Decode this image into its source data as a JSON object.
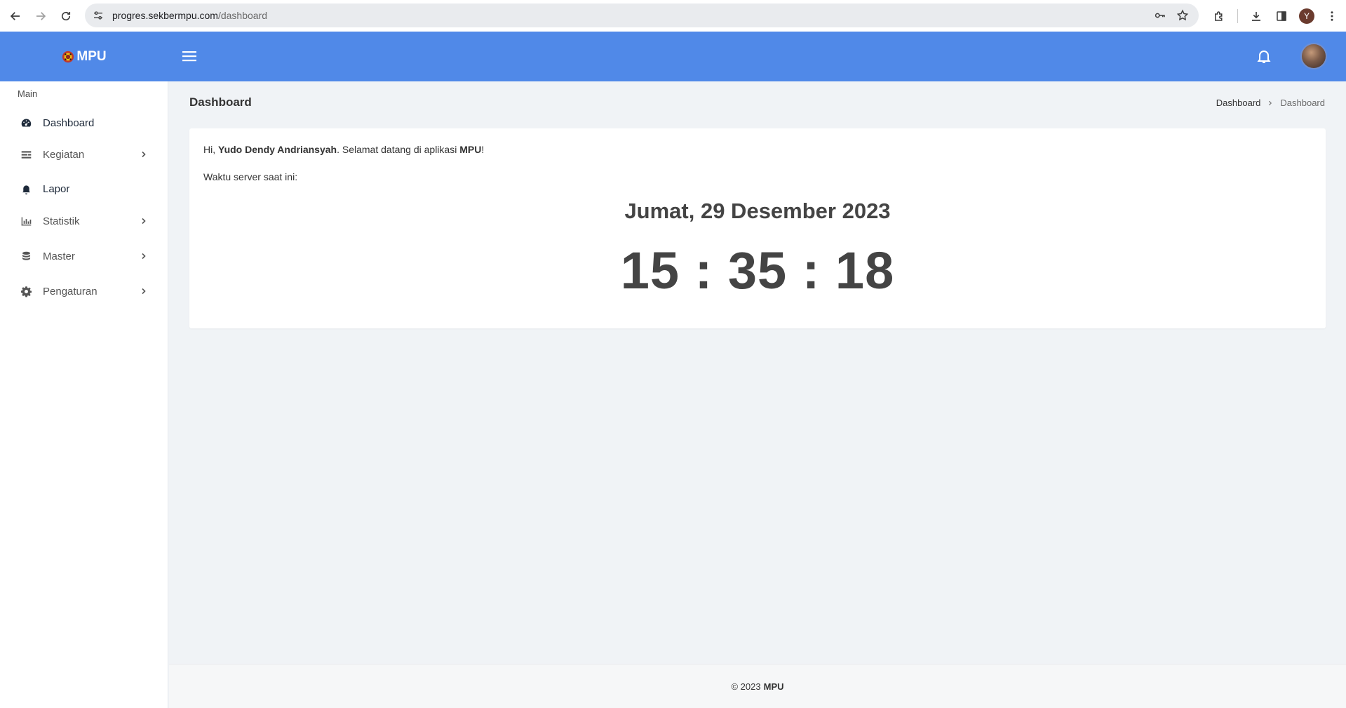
{
  "browser": {
    "url_host": "progres.sekbermpu.com",
    "url_path": "/dashboard",
    "profile_initial": "Y"
  },
  "header": {
    "brand": "MPU",
    "icons": [
      "hamburger-icon",
      "bell-icon",
      "avatar"
    ],
    "color": "#5089e8"
  },
  "sidebar": {
    "section_label": "Main",
    "items": [
      {
        "label": "Dashboard",
        "icon": "dashboard-icon",
        "has_children": false
      },
      {
        "label": "Kegiatan",
        "icon": "list-icon",
        "has_children": true
      },
      {
        "label": "Lapor",
        "icon": "bell-icon",
        "has_children": false
      },
      {
        "label": "Statistik",
        "icon": "bar-chart-icon",
        "has_children": true
      },
      {
        "label": "Master",
        "icon": "database-icon",
        "has_children": true
      },
      {
        "label": "Pengaturan",
        "icon": "gear-icon",
        "has_children": true
      }
    ]
  },
  "main": {
    "page_title": "Dashboard",
    "breadcrumb": {
      "link": "Dashboard",
      "current": "Dashboard"
    },
    "card": {
      "greeting_prefix": "Hi,",
      "user_name": "Yudo Dendy Andriansyah",
      "greeting_middle": ". Selamat datang di aplikasi",
      "app_name": "MPU",
      "greeting_suffix": "!",
      "server_time_label": "Waktu server saat ini:",
      "date": "Jumat, 29 Desember 2023",
      "time": "15 : 35 : 18"
    }
  },
  "footer": {
    "copyright": "© 2023",
    "brand": "MPU"
  }
}
